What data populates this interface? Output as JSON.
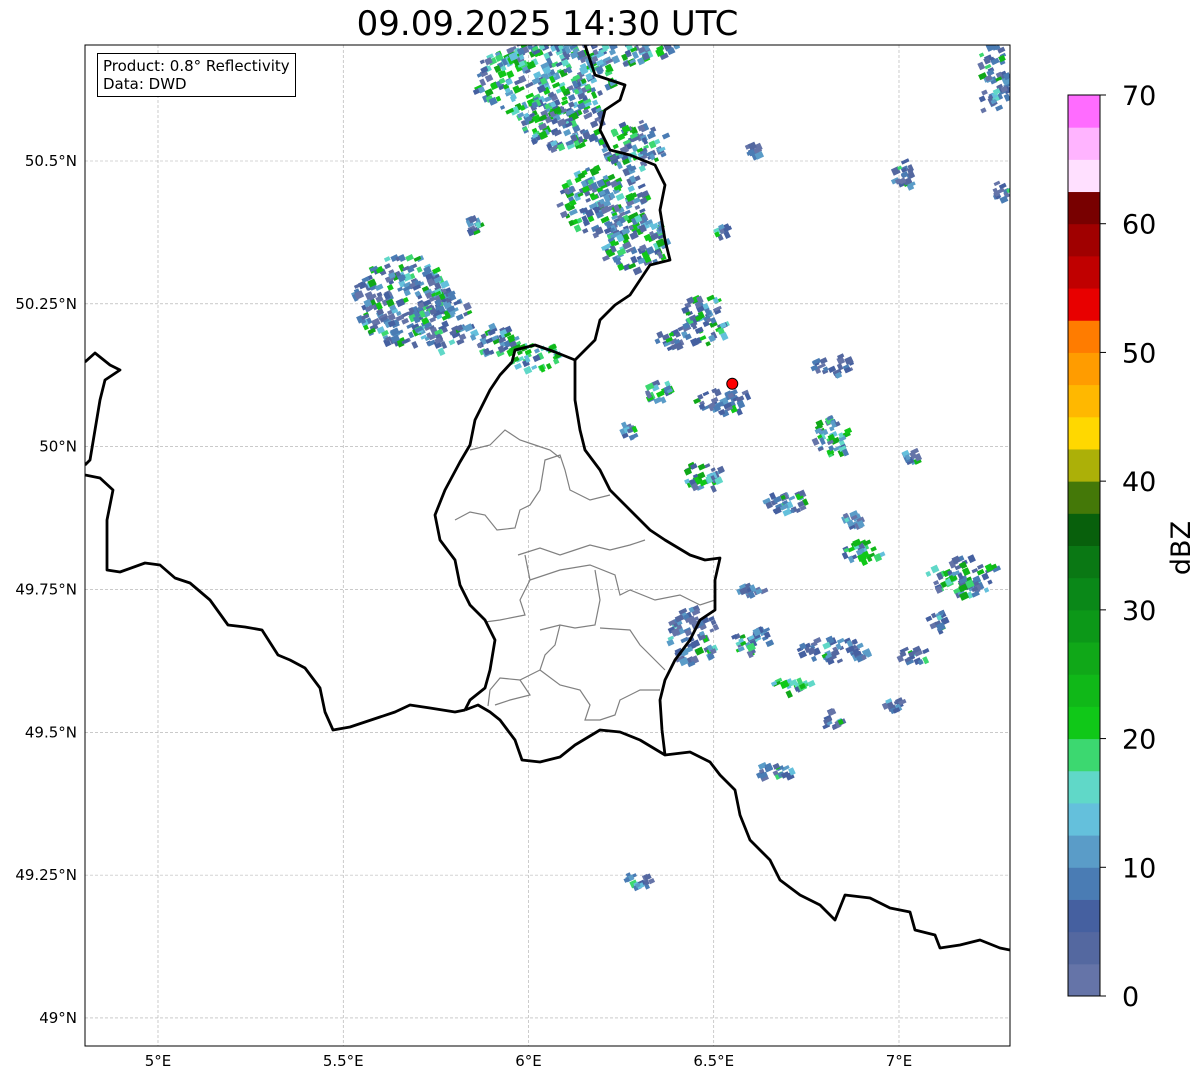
{
  "title": "09.09.2025 14:30 UTC",
  "info": {
    "product": "Product: 0.8° Reflectivity",
    "data": "Data: DWD"
  },
  "axes": {
    "lon_ticks": [
      {
        "value": 5,
        "label": "5°E"
      },
      {
        "value": 5.5,
        "label": "5.5°E"
      },
      {
        "value": 6,
        "label": "6°E"
      },
      {
        "value": 6.5,
        "label": "6.5°E"
      },
      {
        "value": 7,
        "label": "7°E"
      }
    ],
    "lat_ticks": [
      {
        "value": 49,
        "label": "49°N"
      },
      {
        "value": 49.25,
        "label": "49.25°N"
      },
      {
        "value": 49.5,
        "label": "49.5°N"
      },
      {
        "value": 49.75,
        "label": "49.75°N"
      },
      {
        "value": 50,
        "label": "50°N"
      },
      {
        "value": 50.25,
        "label": "50.25°N"
      },
      {
        "value": 50.5,
        "label": "50.5°N"
      }
    ],
    "lon_range": [
      4.8,
      7.3
    ],
    "lat_range": [
      48.95,
      50.7
    ]
  },
  "marker": {
    "lon": 6.55,
    "lat": 50.11,
    "color": "#ff0000"
  },
  "colorbar": {
    "label": "dBZ",
    "min": 0,
    "max": 70,
    "step": 2.5,
    "ticks": [
      {
        "value": 0,
        "label": "0"
      },
      {
        "value": 10,
        "label": "10"
      },
      {
        "value": 20,
        "label": "20"
      },
      {
        "value": 30,
        "label": "30"
      },
      {
        "value": 40,
        "label": "40"
      },
      {
        "value": 50,
        "label": "50"
      },
      {
        "value": 60,
        "label": "60"
      },
      {
        "value": 70,
        "label": "70"
      }
    ],
    "colors": [
      "#6574a8",
      "#5468a0",
      "#4560a0",
      "#4a7cb4",
      "#5a9cc8",
      "#64c0dc",
      "#60d8c8",
      "#3cd870",
      "#10c818",
      "#10b818",
      "#10a818",
      "#0c9818",
      "#0a8818",
      "#0a7814",
      "#08600c",
      "#447808",
      "#acb008",
      "#ffd800",
      "#ffb800",
      "#ff9c00",
      "#ff7c00",
      "#e80000",
      "#c00000",
      "#a00000",
      "#780000",
      "#ffe0ff",
      "#ffb4ff",
      "#ff6cff",
      "#e838f0"
    ]
  }
}
